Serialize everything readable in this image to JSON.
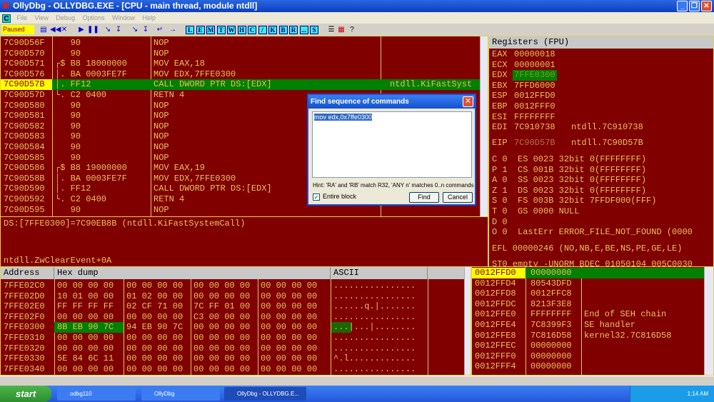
{
  "window": {
    "title": "OllyDbg - OLLYDBG.EXE - [CPU - main thread, module ntdll]",
    "minimize": "_",
    "restore": "❐",
    "close": "✕"
  },
  "menu": {
    "c_icon": "C",
    "items": [
      "File",
      "View",
      "Debug",
      "Options",
      "Window",
      "Help"
    ]
  },
  "toolbar": {
    "status": "Paused",
    "buttons": [
      "open-icon",
      "rewind-icon",
      "close-icon",
      "run-icon",
      "pause-icon",
      "step-into-icon",
      "step-over-icon",
      "trace-into-icon",
      "trace-over-icon",
      "execute-till-return-icon",
      "go-to-icon"
    ],
    "letters": [
      "L",
      "E",
      "M",
      "T",
      "W",
      "H",
      "C",
      "/",
      "K",
      "B",
      "R",
      "...",
      "S"
    ]
  },
  "colors": {
    "background": "#800000",
    "text": "#e8c060",
    "highlight": "#008000",
    "address_highlight": "#ffff00"
  },
  "disasm": {
    "rows": [
      {
        "addr": "7C90D56F",
        "hex": "   90",
        "asm": "NOP",
        "comment": ""
      },
      {
        "addr": "7C90D570",
        "hex": "   90",
        "asm": "NOP",
        "comment": ""
      },
      {
        "addr": "7C90D571",
        "hex": "┌$ B8 18000000",
        "asm": "MOV EAX,18",
        "comment": ""
      },
      {
        "addr": "7C90D576",
        "hex": "│. BA 0003FE7F",
        "asm": "MOV EDX,7FFE0300",
        "comment": ""
      },
      {
        "addr": "7C90D57B",
        "hex": "│. FF12",
        "asm": "CALL DWORD PTR DS:[EDX]",
        "comment": "ntdll.KiFastSyst",
        "selected": true
      },
      {
        "addr": "7C90D57D",
        "hex": "└. C2 0400",
        "asm": "RETN 4",
        "comment": ""
      },
      {
        "addr": "7C90D580",
        "hex": "   90",
        "asm": "NOP",
        "comment": ""
      },
      {
        "addr": "7C90D581",
        "hex": "   90",
        "asm": "NOP",
        "comment": ""
      },
      {
        "addr": "7C90D582",
        "hex": "   90",
        "asm": "NOP",
        "comment": ""
      },
      {
        "addr": "7C90D583",
        "hex": "   90",
        "asm": "NOP",
        "comment": ""
      },
      {
        "addr": "7C90D584",
        "hex": "   90",
        "asm": "NOP",
        "comment": ""
      },
      {
        "addr": "7C90D585",
        "hex": "   90",
        "asm": "NOP",
        "comment": ""
      },
      {
        "addr": "7C90D586",
        "hex": "┌$ B8 19000000",
        "asm": "MOV EAX,19",
        "comment": ""
      },
      {
        "addr": "7C90D58B",
        "hex": "│. BA 0003FE7F",
        "asm": "MOV EDX,7FFE0300",
        "comment": ""
      },
      {
        "addr": "7C90D590",
        "hex": "│. FF12",
        "asm": "CALL DWORD PTR DS:[EDX]",
        "comment": ""
      },
      {
        "addr": "7C90D592",
        "hex": "└. C2 0400",
        "asm": "RETN 4",
        "comment": ""
      },
      {
        "addr": "7C90D595",
        "hex": "   90",
        "asm": "NOP",
        "comment": ""
      }
    ]
  },
  "info": {
    "line1": "DS:[7FFE0300]=7C90EB8B (ntdll.KiFastSystemCall)",
    "line2": "ntdll.ZwClearEvent+0A"
  },
  "registers": {
    "header": "Registers (FPU)",
    "lines": [
      {
        "name": "EAX",
        "value": "00000018",
        "extra": ""
      },
      {
        "name": "ECX",
        "value": "00000001",
        "extra": ""
      },
      {
        "name": "EDX",
        "value": "7FFE0300",
        "extra": "",
        "changed": true
      },
      {
        "name": "EBX",
        "value": "7FFD6000",
        "extra": ""
      },
      {
        "name": "ESP",
        "value": "0012FFD0",
        "extra": ""
      },
      {
        "name": "EBP",
        "value": "0012FFF0",
        "extra": ""
      },
      {
        "name": "ESI",
        "value": "FFFFFFFF",
        "extra": ""
      },
      {
        "name": "EDI",
        "value": "7C910738",
        "extra": "ntdll.7C910738"
      }
    ],
    "eip": {
      "name": "EIP",
      "value": "7C90D57B",
      "extra": "ntdll.7C90D57B"
    },
    "flags": [
      "C 0  ES 0023 32bit 0(FFFFFFFF)",
      "P 1  CS 001B 32bit 0(FFFFFFFF)",
      "A 0  SS 0023 32bit 0(FFFFFFFF)",
      "Z 1  DS 0023 32bit 0(FFFFFFFF)",
      "S 0  FS 003B 32bit 7FFDF000(FFF)",
      "T 0  GS 0000 NULL",
      "D 0",
      "O 0  LastErr ERROR_FILE_NOT_FOUND (0000"
    ],
    "efl": "EFL 00000246 (NO,NB,E,BE,NS,PE,GE,LE)",
    "st0": "ST0 empty -UNORM BDEC 01050104 005C0030"
  },
  "dump": {
    "headers": {
      "address": "Address",
      "hex": "Hex dump",
      "ascii": "ASCII"
    },
    "rows": [
      {
        "addr": "7FFE02C0",
        "hex": [
          "00 00 00 00",
          "00 00 00 00",
          "00 00 00 00",
          "00 00 00 00"
        ],
        "ascii": "................"
      },
      {
        "addr": "7FFE02D0",
        "hex": [
          "10 01 00 00",
          "01 02 00 00",
          "00 00 00 00",
          "00 00 00 00"
        ],
        "ascii": "................"
      },
      {
        "addr": "7FFE02E0",
        "hex": [
          "FF FF FF FF",
          "02 CF 71 00",
          "7C FF 01 00",
          "00 00 00 00"
        ],
        "ascii": "......q.|......."
      },
      {
        "addr": "7FFE02F0",
        "hex": [
          "00 00 00 00",
          "00 00 00 00",
          "C3 00 00 00",
          "00 00 00 00"
        ],
        "ascii": "................"
      },
      {
        "addr": "7FFE0300",
        "hex": [
          "8B EB 90 7C",
          "94 EB 90 7C",
          "00 00 00 00",
          "00 00 00 00"
        ],
        "ascii": "...|...|........",
        "selected": true
      },
      {
        "addr": "7FFE0310",
        "hex": [
          "00 00 00 00",
          "00 00 00 00",
          "00 00 00 00",
          "00 00 00 00"
        ],
        "ascii": "................"
      },
      {
        "addr": "7FFE0320",
        "hex": [
          "00 00 00 00",
          "00 00 00 00",
          "00 00 00 00",
          "00 00 00 00"
        ],
        "ascii": "................"
      },
      {
        "addr": "7FFE0330",
        "hex": [
          "5E 84 6C 11",
          "00 00 00 00",
          "00 00 00 00",
          "00 00 00 00"
        ],
        "ascii": "^.l............."
      },
      {
        "addr": "7FFE0340",
        "hex": [
          "00 00 00 00",
          "00 00 00 00",
          "00 00 00 00",
          "00 00 00 00"
        ],
        "ascii": "................"
      }
    ]
  },
  "stack": {
    "rows": [
      {
        "addr": "0012FFD0",
        "value": "00000000",
        "comment": "",
        "selected": true
      },
      {
        "addr": "0012FFD4",
        "value": "80543DFD",
        "comment": ""
      },
      {
        "addr": "0012FFD8",
        "value": "0012FFC8",
        "comment": ""
      },
      {
        "addr": "0012FFDC",
        "value": "8213F3E8",
        "comment": ""
      },
      {
        "addr": "0012FFE0",
        "value": "FFFFFFFF",
        "comment": "End of SEH chain"
      },
      {
        "addr": "0012FFE4",
        "value": "7C8399F3",
        "comment": "SE handler"
      },
      {
        "addr": "0012FFE8",
        "value": "7C816D58",
        "comment": "kernel32.7C816D58"
      },
      {
        "addr": "0012FFEC",
        "value": "00000000",
        "comment": ""
      },
      {
        "addr": "0012FFF0",
        "value": "00000000",
        "comment": ""
      },
      {
        "addr": "0012FFF4",
        "value": "00000000",
        "comment": ""
      }
    ]
  },
  "dialog": {
    "title": "Find sequence of commands",
    "close": "✕",
    "text": "mov edx,0x7ffe0300",
    "hint": "Hint: 'RA' and 'RB' match R32, 'ANY n' matches 0..n commands",
    "checkbox_label": "Entire block",
    "checkbox_checked": true,
    "check": "✔",
    "find": "Find",
    "cancel": "Cancel"
  },
  "taskbar": {
    "start": "start",
    "tasks": [
      "odbg110",
      "OllyDbg",
      "OllyDbg - OLLYDBG.E..."
    ],
    "clock": "1:14 AM"
  }
}
